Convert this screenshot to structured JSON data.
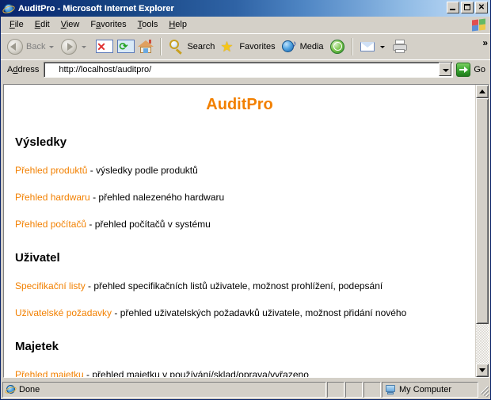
{
  "window": {
    "title": "AuditPro - Microsoft Internet Explorer",
    "minimize_label": "_",
    "maximize_label": "",
    "close_label": "✕",
    "app_icon": "internet-explorer-icon"
  },
  "menu": {
    "items": [
      {
        "label": "File",
        "accel": "F"
      },
      {
        "label": "Edit",
        "accel": "E"
      },
      {
        "label": "View",
        "accel": "V"
      },
      {
        "label": "Favorites",
        "accel": "a"
      },
      {
        "label": "Tools",
        "accel": "T"
      },
      {
        "label": "Help",
        "accel": "H"
      }
    ],
    "brand_icon": "windows-flag-icon"
  },
  "toolbar": {
    "back_label": "Back",
    "forward_label": "",
    "stop_label": "",
    "refresh_label": "",
    "home_label": "",
    "search_label": "Search",
    "favorites_label": "Favorites",
    "media_label": "Media",
    "history_label": "",
    "mail_label": "",
    "print_label": "",
    "overflow_label": "»"
  },
  "address": {
    "label": "Address",
    "value": "http://localhost/auditpro/",
    "placeholder": "",
    "go_label": "Go"
  },
  "page": {
    "title": "AuditPro",
    "sections": [
      {
        "heading": "Výsledky",
        "rows": [
          {
            "link": "Přehled produktů",
            "desc": " - výsledky podle produktů"
          },
          {
            "link": "Přehled hardwaru",
            "desc": " - přehled nalezeného hardwaru"
          },
          {
            "link": "Přehled počítačů",
            "desc": " - přehled počítačů v systému"
          }
        ]
      },
      {
        "heading": "Uživatel",
        "rows": [
          {
            "link": "Specifikační listy",
            "desc": " - přehled specifikačních listů uživatele, možnost prohlížení, podepsání"
          },
          {
            "link": "Uživatelské požadavky",
            "desc": " - přehled uživatelských požadavků uživatele, možnost přidání nového"
          }
        ]
      },
      {
        "heading": "Majetek",
        "rows": [
          {
            "link": "Přehled majetku",
            "desc": " - přehled majetku v používání/sklad/oprava/vyřazeno"
          }
        ]
      }
    ]
  },
  "statusbar": {
    "status_text": "Done",
    "zone_text": "My Computer"
  },
  "colors": {
    "accent_orange": "#f28000",
    "title_gradient_start": "#0a246a",
    "title_gradient_end": "#bdd8f3",
    "chrome": "#d4d0c8"
  }
}
